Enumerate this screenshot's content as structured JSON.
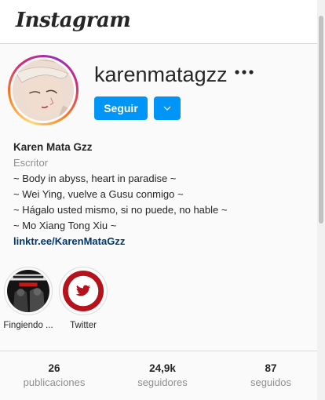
{
  "app": {
    "logo_text": "Instagram"
  },
  "profile": {
    "username": "karenmatagzz",
    "more_icon": "more-horizontal-icon",
    "follow_label": "Seguir",
    "dropdown_icon": "chevron-down-icon",
    "full_name": "Karen Mata Gzz",
    "category": "Escritor",
    "bio_lines": [
      "~ Body in abyss, heart in paradise ~",
      "~ Wei Ying, vuelve a Gusu conmigo ~",
      "~ Hágalo usted mismo, si no puede, no hable ~",
      "~ Mo Xiang Tong Xiu ~"
    ],
    "link": "linktr.ee/KarenMataGzz"
  },
  "highlights": [
    {
      "label": "Fingiendo ..."
    },
    {
      "label": "Twitter"
    }
  ],
  "stats": [
    {
      "value": "26",
      "label": "publicaciones"
    },
    {
      "value": "24,9k",
      "label": "seguidores"
    },
    {
      "value": "87",
      "label": "seguidos"
    }
  ],
  "colors": {
    "accent": "#0095f6",
    "link": "#00376b",
    "muted": "#8e8e8e",
    "twitter_red": "#b5121b"
  }
}
